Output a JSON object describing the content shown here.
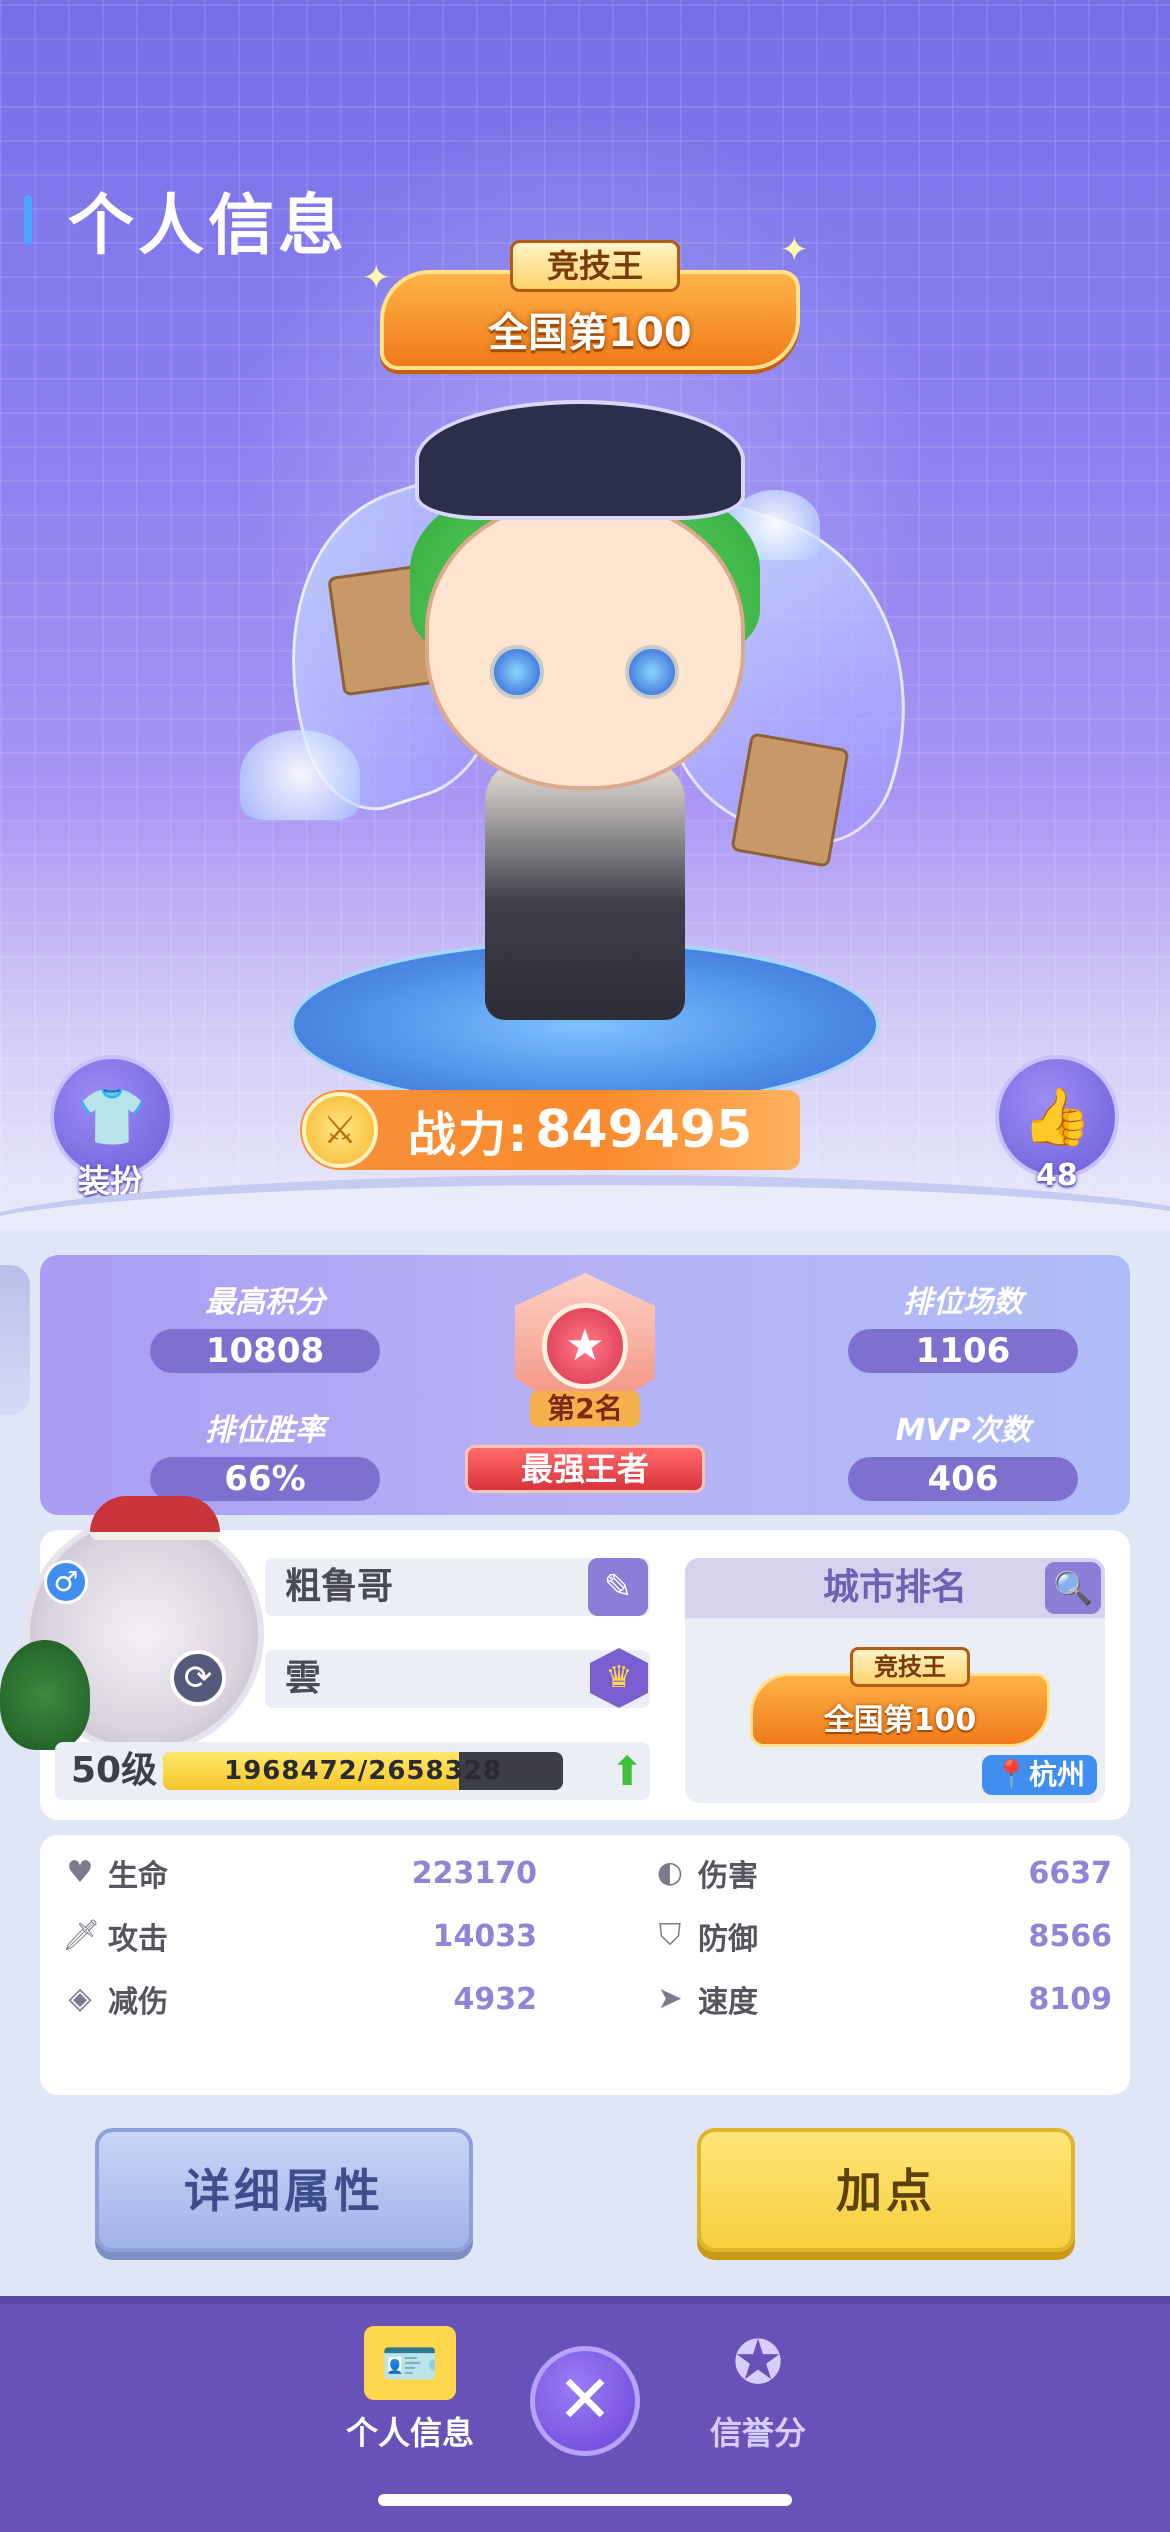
{
  "header": {
    "title": "个人信息"
  },
  "rank_banner": {
    "top_label": "竞技王",
    "main_label": "全国第100"
  },
  "power": {
    "label": "战力:",
    "value": "849495"
  },
  "dress_button": {
    "label": "装扮"
  },
  "like_button": {
    "count": "48"
  },
  "rank_stats": {
    "highest_score": {
      "label": "最高积分",
      "value": "10808"
    },
    "win_rate": {
      "label": "排位胜率",
      "value": "66%"
    },
    "ranked_matches": {
      "label": "排位场数",
      "value": "1106"
    },
    "mvp_count": {
      "label": "MVP次数",
      "value": "406"
    },
    "badge": {
      "place": "第2名",
      "title": "最强王者"
    }
  },
  "profile": {
    "name": "粗鲁哥",
    "clan": "雲",
    "level": "50级",
    "exp_text": "1968472/2658328",
    "exp_fraction": 0.74
  },
  "city_rank": {
    "title": "城市排名",
    "banner_top": "竞技王",
    "banner_main": "全国第100",
    "location": "杭州"
  },
  "attributes": [
    {
      "name": "生命",
      "value": "223170",
      "icon": "heart-icon"
    },
    {
      "name": "攻击",
      "value": "14033",
      "icon": "sword-icon"
    },
    {
      "name": "减伤",
      "value": "4932",
      "icon": "armor-icon"
    },
    {
      "name": "伤害",
      "value": "6637",
      "icon": "globe-damage-icon"
    },
    {
      "name": "防御",
      "value": "8566",
      "icon": "shield-icon"
    },
    {
      "name": "速度",
      "value": "8109",
      "icon": "boot-icon"
    }
  ],
  "buttons": {
    "detail": "详细属性",
    "add_points": "加点"
  },
  "bottom_nav": {
    "info_label": "个人信息",
    "credit_label": "信誉分"
  },
  "colors": {
    "accent_purple": "#6753b8",
    "stat_value_purple": "#8e85d6",
    "power_orange": "#f7913b",
    "add_points_yellow": "#f7cf3d"
  }
}
